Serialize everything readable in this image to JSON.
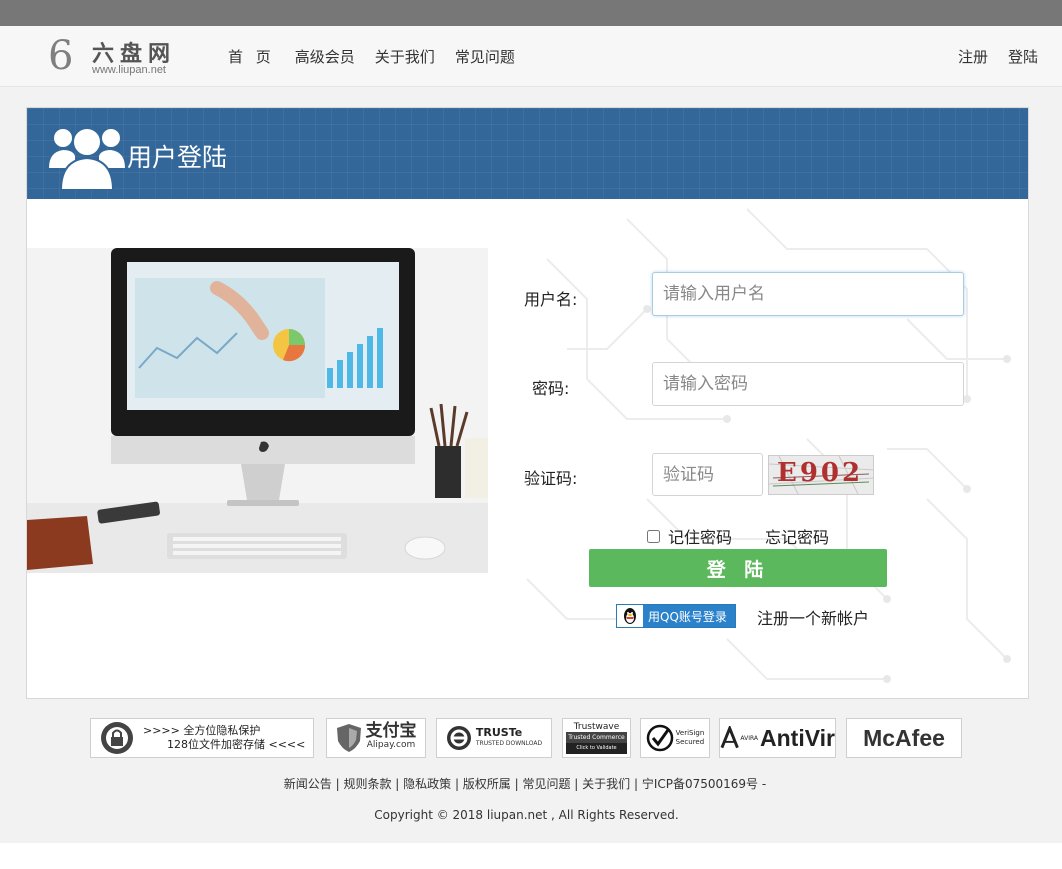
{
  "site": {
    "logo_digit": "6",
    "logo_name": "六盘网",
    "logo_url": "www.liupan.net"
  },
  "nav": {
    "items": [
      "首 页",
      "高级会员",
      "关于我们",
      "常见问题"
    ]
  },
  "auth": {
    "register": "注册",
    "login": "登陆"
  },
  "card": {
    "title": "用户登陆",
    "accent_color": "#336699"
  },
  "form": {
    "username_label": "用户名:",
    "username_placeholder": "请输入用户名",
    "password_label": "密码:",
    "password_placeholder": "请输入密码",
    "captcha_label": "验证码:",
    "captcha_placeholder": "验证码",
    "captcha_text": "E902",
    "remember_label": "记住密码",
    "forgot_label": "忘记密码",
    "login_button": "登 陆",
    "login_button_color": "#5cb85c",
    "qq_login": "用QQ账号登录",
    "register_new": "注册一个新帐户"
  },
  "badges": [
    {
      "name": "privacy",
      "line1": "全方位隐私保护",
      "line2": "128位文件加密存储"
    },
    {
      "name": "alipay",
      "title": "支付宝",
      "sub": "Alipay.com"
    },
    {
      "name": "truste",
      "title": "TRUSTe",
      "sub": "TRUSTED DOWNLOAD"
    },
    {
      "name": "trustwave",
      "title": "Trustwave",
      "sub": "Trusted Commerce",
      "sub2": "Click to Validate"
    },
    {
      "name": "verisign",
      "title": "VeriSign",
      "sub": "Secured"
    },
    {
      "name": "antivir",
      "prefix": "AVIRA",
      "title": "AntiVir"
    },
    {
      "name": "mcafee",
      "title": "McAfee"
    }
  ],
  "footer": {
    "links": "新闻公告 | 规则条款 | 隐私政策 | 版权所属 | 常见问题 | 关于我们 | 宁ICP备07500169号 -",
    "copyright": "Copyright © 2018 liupan.net , All Rights Reserved."
  }
}
